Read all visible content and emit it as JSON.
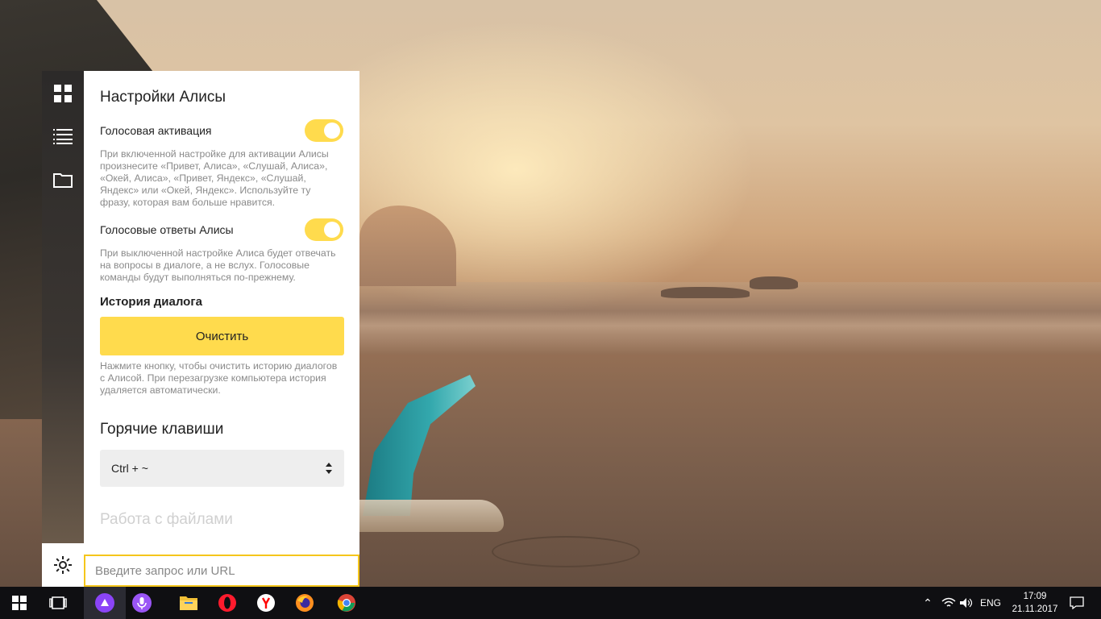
{
  "panel": {
    "title": "Настройки Алисы",
    "voice_activation": {
      "label": "Голосовая активация",
      "enabled": true,
      "description": "При включенной настройке для активации Алисы произнесите «Привет, Алиса», «Слушай, Алиса», «Окей, Алиса», «Привет, Яндекс», «Слушай, Яндекс» или «Окей, Яндекс». Используйте ту фразу, которая вам больше нравится."
    },
    "voice_answers": {
      "label": "Голосовые ответы Алисы",
      "enabled": true,
      "description": "При выключенной настройке Алиса будет отвечать на вопросы в диалоге, а не вслух. Голосовые команды будут выполняться по-прежнему."
    },
    "history": {
      "title": "История диалога",
      "clear_label": "Очистить",
      "description": "Нажмите кнопку, чтобы очистить историю диалогов с Алисой. При перезагрузке компьютера история удаляется автоматически."
    },
    "hotkeys": {
      "title": "Горячие клавиши",
      "selected": "Ctrl + ~"
    },
    "files_title": "Работа с файлами"
  },
  "search": {
    "placeholder": "Введите запрос или URL"
  },
  "sidebar": {
    "items": [
      {
        "icon": "grid-icon"
      },
      {
        "icon": "list-icon"
      },
      {
        "icon": "folder-icon"
      }
    ],
    "bottom_icon": "gear-icon"
  },
  "taskbar": {
    "apps": [
      "windows-start-icon",
      "task-view-icon",
      "alice-icon",
      "microphone-icon",
      "file-explorer-icon",
      "opera-icon",
      "yandex-browser-icon",
      "firefox-icon",
      "chrome-icon"
    ],
    "language": "ENG",
    "time": "17:09",
    "date": "21.11.2017"
  },
  "colors": {
    "accent_yellow": "#ffdb4d",
    "alice_purple": "#8b44f7",
    "arrow_red": "#e8331f"
  }
}
